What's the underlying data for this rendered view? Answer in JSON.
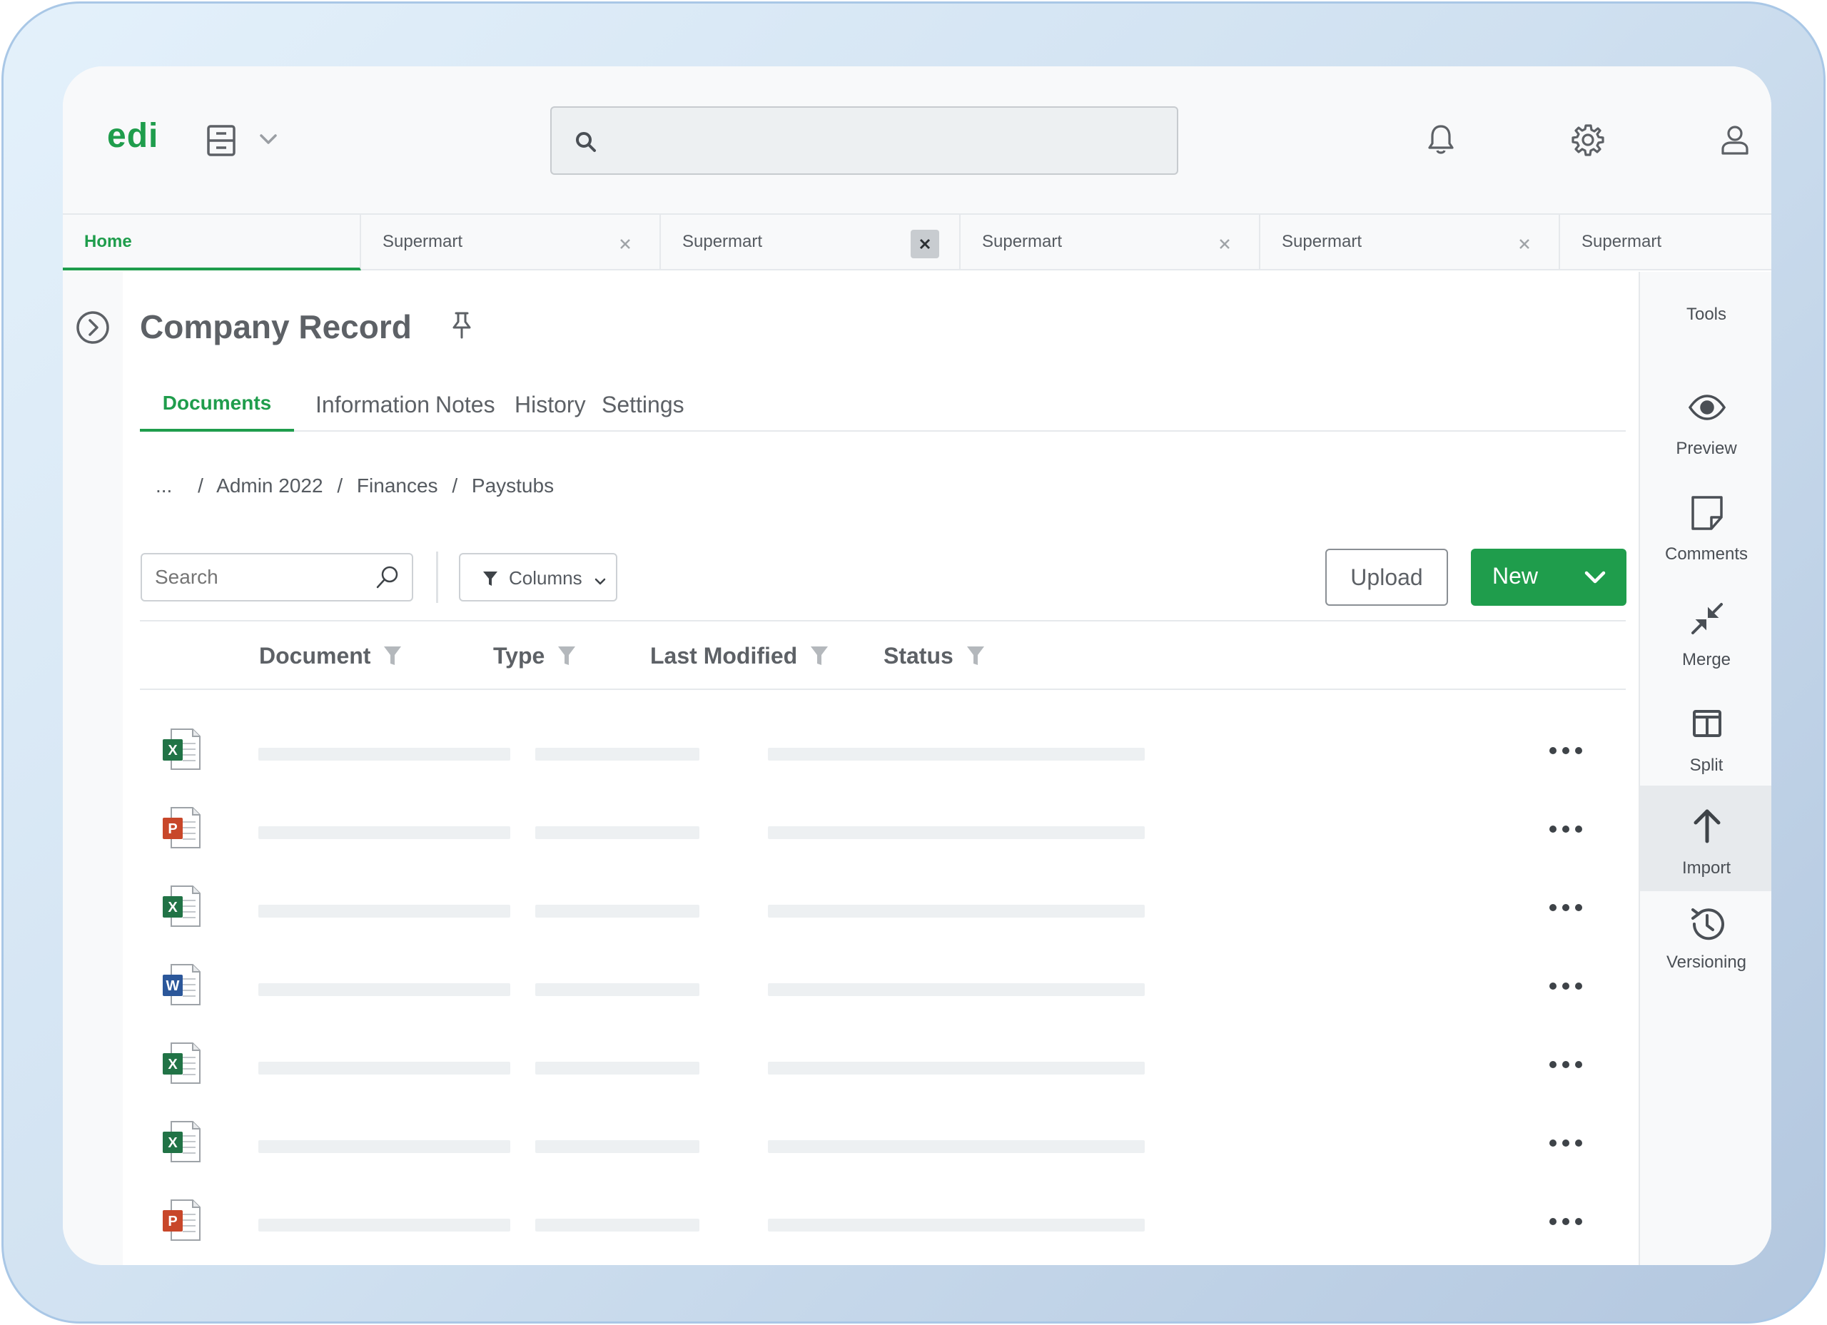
{
  "app": {
    "logo": "edi"
  },
  "search": {
    "placeholder": ""
  },
  "tabs": [
    {
      "label": "Home"
    },
    {
      "label": "Supermart"
    },
    {
      "label": "Supermart"
    },
    {
      "label": "Supermart"
    },
    {
      "label": "Supermart"
    },
    {
      "label": "Supermart"
    }
  ],
  "page": {
    "title": "Company Record"
  },
  "subtabs": [
    "Documents",
    "Information",
    "Notes",
    "History",
    "Settings"
  ],
  "breadcrumb": {
    "ellipsis": "...",
    "items": [
      "Admin 2022",
      "Finances",
      "Paystubs"
    ],
    "sep": "/"
  },
  "toolbar": {
    "search_placeholder": "Search",
    "columns_label": "Columns",
    "upload_label": "Upload",
    "new_label": "New"
  },
  "table": {
    "columns": [
      "Document",
      "Type",
      "Last Modified",
      "Status"
    ],
    "rows": [
      {
        "file_type": "excel"
      },
      {
        "file_type": "powerpoint"
      },
      {
        "file_type": "excel"
      },
      {
        "file_type": "word"
      },
      {
        "file_type": "excel"
      },
      {
        "file_type": "excel"
      },
      {
        "file_type": "powerpoint"
      }
    ]
  },
  "tools": {
    "heading": "Tools",
    "items": [
      {
        "label": "Preview",
        "icon": "eye-icon"
      },
      {
        "label": "Comments",
        "icon": "note-icon"
      },
      {
        "label": "Merge",
        "icon": "merge-icon"
      },
      {
        "label": "Split",
        "icon": "split-icon"
      },
      {
        "label": "Import",
        "icon": "arrow-up-icon",
        "active": true
      },
      {
        "label": "Versioning",
        "icon": "history-icon"
      }
    ]
  },
  "colors": {
    "accent": "#1f9d4c",
    "excel": "#217346",
    "powerpoint": "#c8472a",
    "word": "#2b579a"
  }
}
